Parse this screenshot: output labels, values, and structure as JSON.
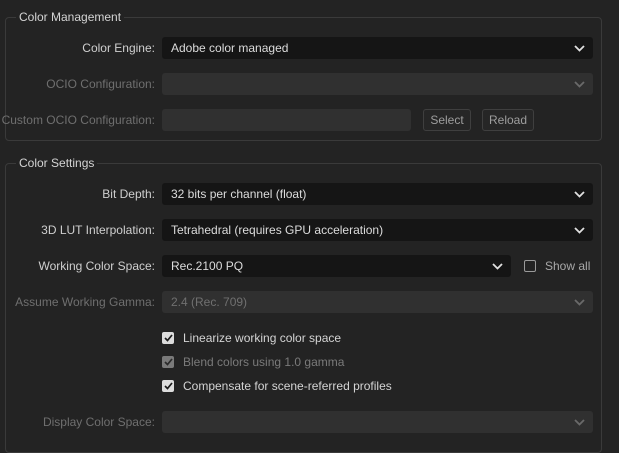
{
  "color_management": {
    "title": "Color Management",
    "color_engine": {
      "label": "Color Engine:",
      "value": "Adobe color managed"
    },
    "ocio_configuration": {
      "label": "OCIO Configuration:",
      "value": ""
    },
    "custom_ocio_configuration": {
      "label": "Custom OCIO Configuration:",
      "value": "",
      "select_label": "Select",
      "reload_label": "Reload"
    }
  },
  "color_settings": {
    "title": "Color Settings",
    "bit_depth": {
      "label": "Bit Depth:",
      "value": "32 bits per channel (float)"
    },
    "lut_interpolation": {
      "label": "3D LUT Interpolation:",
      "value": "Tetrahedral (requires GPU acceleration)"
    },
    "working_color_space": {
      "label": "Working Color Space:",
      "value": "Rec.2100 PQ",
      "show_all_label": "Show all",
      "show_all_checked": false
    },
    "assume_working_gamma": {
      "label": "Assume Working Gamma:",
      "value": "2.4 (Rec. 709)"
    },
    "linearize": {
      "label": "Linearize working color space",
      "checked": true
    },
    "blend_colors": {
      "label": "Blend colors using 1.0 gamma",
      "checked": true,
      "disabled": true
    },
    "compensate": {
      "label": "Compensate for scene-referred profiles",
      "checked": true
    },
    "display_color_space": {
      "label": "Display Color Space:",
      "value": ""
    }
  },
  "icons": {
    "dropdown": "chevron-down-icon",
    "checkbox": "checkmark-icon"
  }
}
